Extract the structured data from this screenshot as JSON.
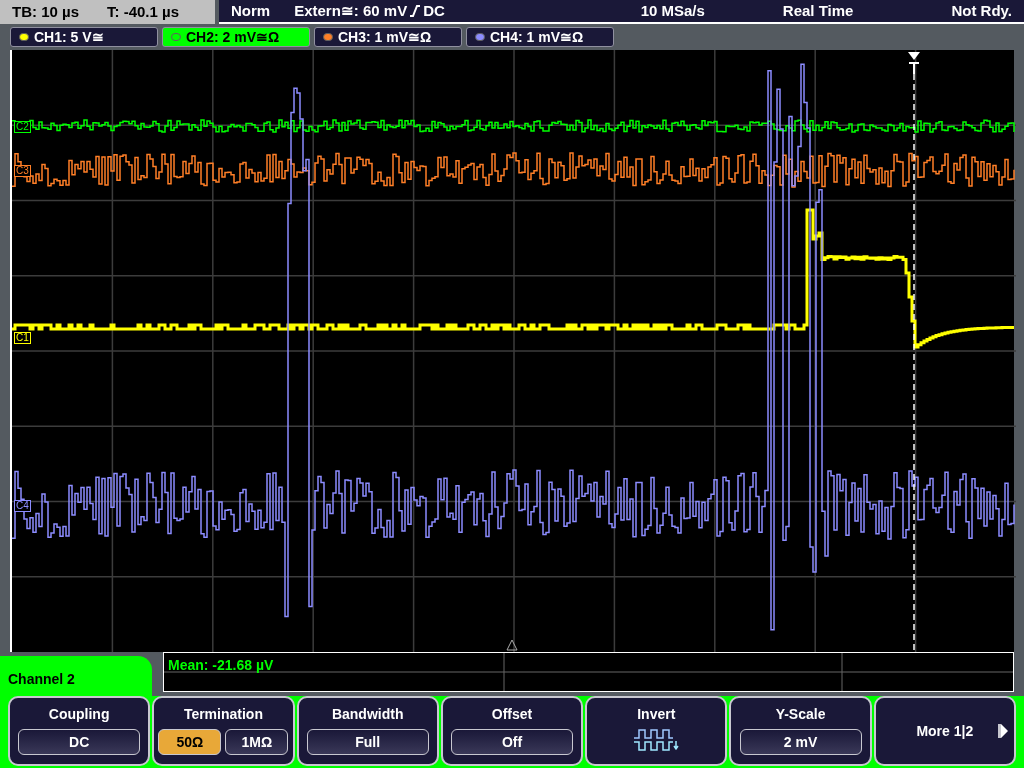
{
  "status_bar": {
    "timebase": "TB: 10 µs",
    "trigger_time": "T: -40.1 µs",
    "mode": "Norm",
    "trigger_level": "Extern≅: 60 mV",
    "trigger_coupling": "DC",
    "sample_rate": "10 MSa/s",
    "acquisition": "Real Time",
    "state": "Not Rdy."
  },
  "channels": [
    {
      "label": "CH1: 5 V≅",
      "color": "#ffff00",
      "selected": false
    },
    {
      "label": "CH2: 2 mV≅Ω",
      "color": "#00ff00",
      "selected": true
    },
    {
      "label": "CH3: 1 mV≅Ω",
      "color": "#ff7f27",
      "selected": false
    },
    {
      "label": "CH4: 1 mV≅Ω",
      "color": "#8c8cff",
      "selected": false
    }
  ],
  "traces": [
    {
      "marker": "C2",
      "kind": "flat",
      "color": "#00ff00"
    },
    {
      "marker": "C3",
      "kind": "noisy",
      "color": "#ff7f27"
    },
    {
      "marker": "C1",
      "kind": "pulse",
      "color": "#ffff00"
    },
    {
      "marker": "C4",
      "kind": "burst",
      "color": "#8c8cff"
    }
  ],
  "measurement": "Mean: -21.68 µV",
  "menu": {
    "title": "Channel 2",
    "softkeys": [
      {
        "kind": "select",
        "label": "Coupling",
        "value": "DC"
      },
      {
        "kind": "toggle",
        "label": "Termination",
        "options": [
          {
            "text": "50Ω",
            "selected": true
          },
          {
            "text": "1MΩ",
            "selected": false
          }
        ]
      },
      {
        "kind": "select",
        "label": "Bandwidth",
        "value": "Full"
      },
      {
        "kind": "select",
        "label": "Offset",
        "value": "Off"
      },
      {
        "kind": "icon",
        "label": "Invert"
      },
      {
        "kind": "select",
        "label": "Y-Scale",
        "value": "2 mV"
      },
      {
        "kind": "next",
        "label": "More 1|2"
      }
    ]
  }
}
